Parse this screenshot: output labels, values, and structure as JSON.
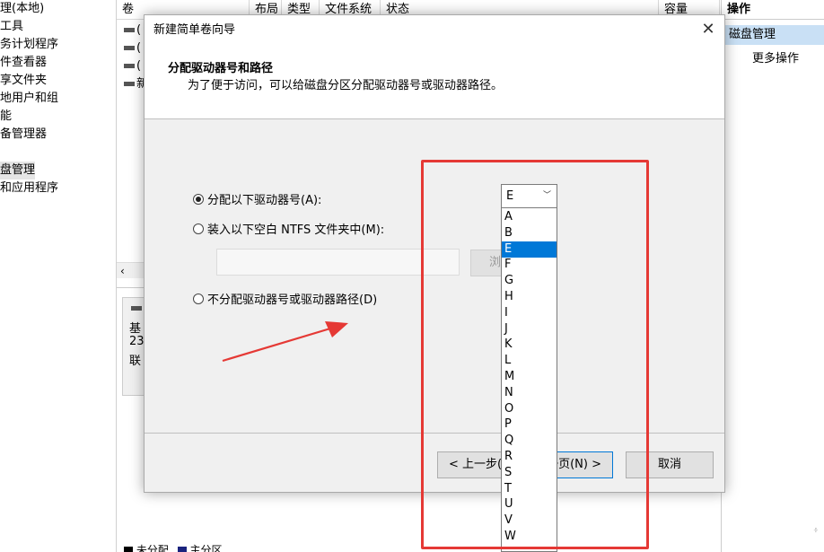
{
  "left_tree": {
    "items": [
      {
        "label": "理(本地)",
        "selected": false
      },
      {
        "label": "工具",
        "selected": false
      },
      {
        "label": "务计划程序",
        "selected": false
      },
      {
        "label": "件查看器",
        "selected": false
      },
      {
        "label": "享文件夹",
        "selected": false
      },
      {
        "label": "地用户和组",
        "selected": false
      },
      {
        "label": "能",
        "selected": false
      },
      {
        "label": "备管理器",
        "selected": false
      },
      {
        "label": "",
        "selected": false
      },
      {
        "label": "盘管理",
        "selected": true
      },
      {
        "label": "和应用程序",
        "selected": false
      }
    ]
  },
  "volume_list": {
    "columns": [
      "卷",
      "布局",
      "类型",
      "文件系统",
      "状态",
      "容量"
    ],
    "rows": [
      "(",
      "(",
      "(",
      "新"
    ]
  },
  "lower_pane": {
    "disk_lines": [
      "基",
      "23",
      "联"
    ],
    "legend": [
      "未分配",
      "主分区"
    ]
  },
  "actions": {
    "title": "操作",
    "selected_item": "磁盘管理",
    "more": "更多操作"
  },
  "wizard": {
    "title": "新建简单卷向导",
    "close_glyph": "✕",
    "header_title": "分配驱动器号和路径",
    "header_desc": "为了便于访问，可以给磁盘分区分配驱动器号或驱动器路径。",
    "options": [
      {
        "label": "分配以下驱动器号(A):",
        "checked": true
      },
      {
        "label": "装入以下空白 NTFS 文件夹中(M):",
        "checked": false
      },
      {
        "label": "不分配驱动器号或驱动器路径(D)",
        "checked": false
      }
    ],
    "ntfs_path_value": "",
    "browse_label": "浏览(R)...",
    "drive_letter": {
      "selected": "E",
      "options": [
        "A",
        "B",
        "E",
        "F",
        "G",
        "H",
        "I",
        "J",
        "K",
        "L",
        "M",
        "N",
        "O",
        "P",
        "Q",
        "R",
        "S",
        "T",
        "U",
        "V",
        "W"
      ]
    },
    "buttons": {
      "back": "< 上一步(B)",
      "next": "下一页(N) >",
      "cancel": "取消"
    }
  },
  "annotation": {
    "color": "#e53935"
  },
  "colors": {
    "accent": "#0078d7",
    "selection": "#c9e0f5"
  }
}
